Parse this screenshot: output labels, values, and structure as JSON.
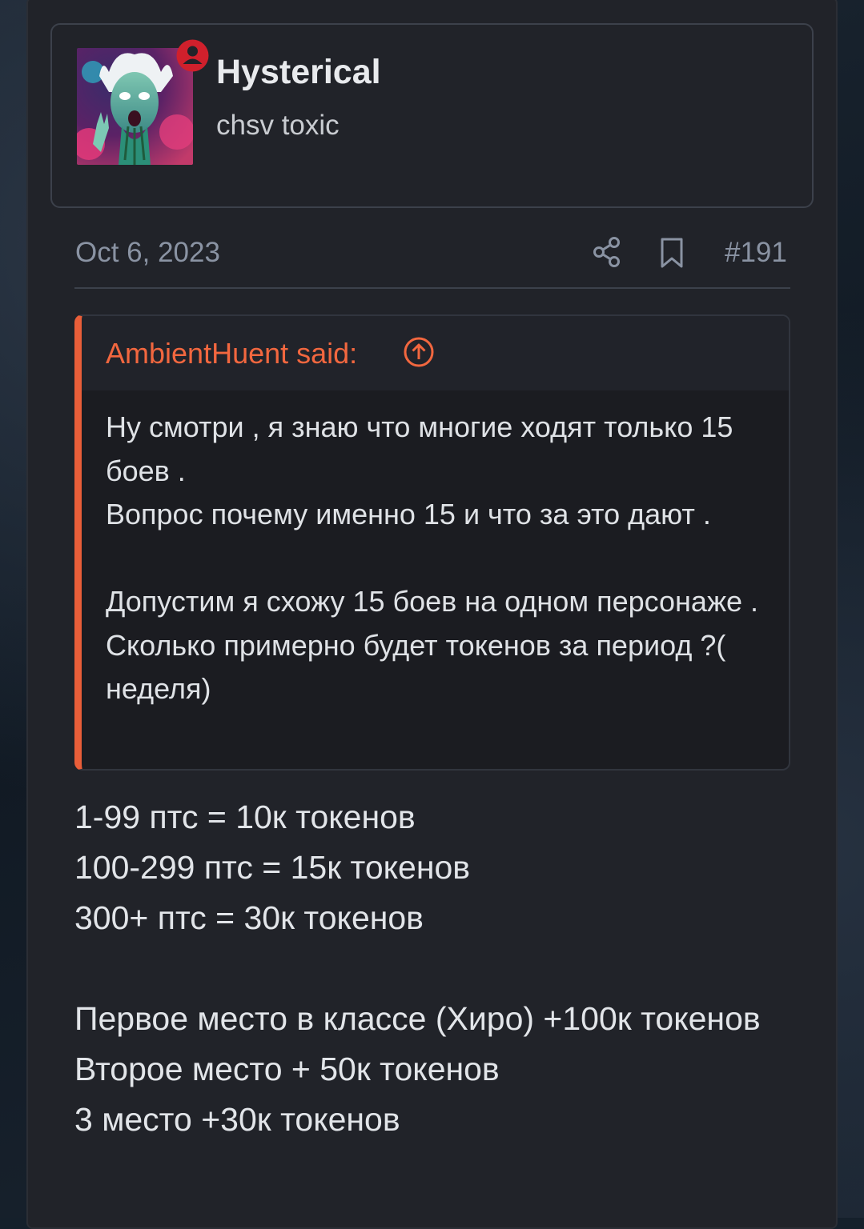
{
  "user": {
    "name": "Hysterical",
    "title": "chsv toxic"
  },
  "post": {
    "date": "Oct 6, 2023",
    "number": "#191"
  },
  "quote": {
    "author": "AmbientHuent said:",
    "lines": [
      "Ну смотри , я знаю что многие ходят только 15 боев .",
      "Вопрос почему именно 15 и что за это дают .",
      "",
      "Допустим я схожу 15 боев на одном персонаже . Сколько примерно будет токенов за период ?( неделя)"
    ]
  },
  "reply": {
    "lines": [
      "1-99 птс = 10к токенов",
      "100-299 птс = 15к токенов",
      "300+ птс = 30к токенов",
      "",
      "Первое место в классе (Хиро) +100к токенов",
      "Второе место + 50к токенов",
      "3 место +30к токенов"
    ]
  },
  "colors": {
    "accent": "#e95e39",
    "quote_author": "#f2673f",
    "online_badge": "#d0202c",
    "muted_text": "#8a93a3"
  },
  "icons": {
    "online": "user-online-icon",
    "share": "share-icon",
    "bookmark": "bookmark-icon",
    "quote_jump": "arrow-up-circle-icon"
  }
}
